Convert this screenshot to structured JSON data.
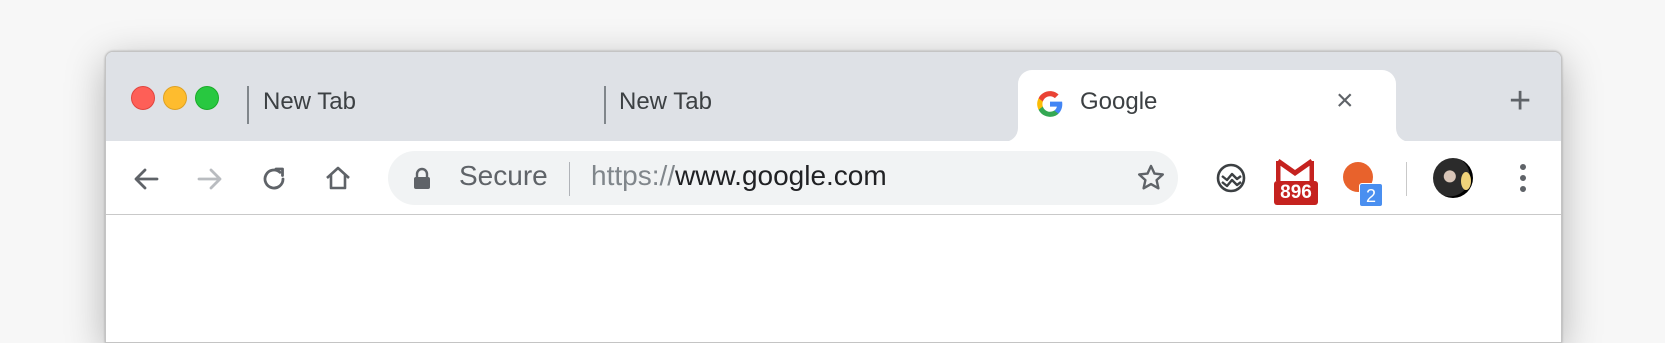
{
  "window": {
    "traffic_lights": [
      "close",
      "minimize",
      "maximize"
    ]
  },
  "tabs": [
    {
      "label": "New Tab",
      "active": false
    },
    {
      "label": "New Tab",
      "active": false
    },
    {
      "label": "Google",
      "active": true,
      "favicon": "google-g-icon"
    }
  ],
  "new_tab_glyph": "+",
  "tab_close_glyph": "×",
  "toolbar": {
    "back_icon": "arrow-left-icon",
    "forward_icon": "arrow-right-icon",
    "reload_icon": "reload-icon",
    "home_icon": "home-icon"
  },
  "omnibox": {
    "secure_label": "Secure",
    "url_prefix": "https://",
    "url_host": "www.google.com",
    "lock_icon": "lock-icon",
    "bookmark_icon": "star-icon"
  },
  "extensions": [
    {
      "icon": "sync-icon"
    },
    {
      "icon": "gmail-icon",
      "badge": "896",
      "badge_color": "#c5221f"
    },
    {
      "icon": "orange-dot-icon",
      "badge": "2",
      "badge_color": "#4a8ff0"
    }
  ],
  "profile": {
    "icon": "avatar"
  },
  "menu_icon": "kebab-menu-icon",
  "colors": {
    "tabstrip": "#dee1e6",
    "omnibox": "#f1f3f4",
    "text": "#3c4043"
  }
}
